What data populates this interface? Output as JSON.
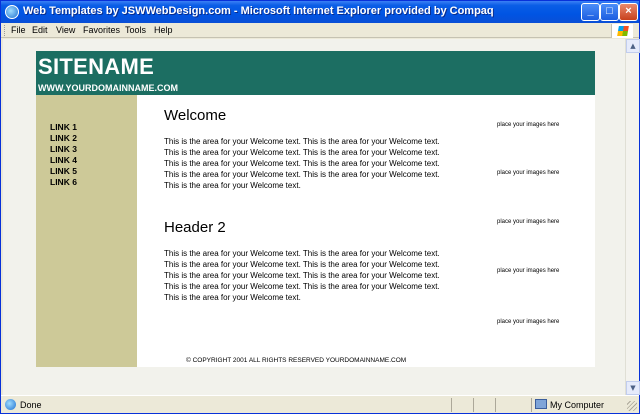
{
  "window": {
    "title": "Web Templates by JSWWebDesign.com - Microsoft Internet Explorer provided by Compaq",
    "buttons": {
      "minimize": "_",
      "maximize": "□",
      "close": "×"
    }
  },
  "menu": {
    "items": [
      "File",
      "Edit",
      "View",
      "Favorites",
      "Tools",
      "Help"
    ]
  },
  "page": {
    "site_name": "SITENAME",
    "domain": "WWW.YOURDOMAINNAME.COM",
    "nav_links": [
      "LINK 1",
      "LINK 2",
      "LINK 3",
      "LINK 4",
      "LINK 5",
      "LINK 6"
    ],
    "sections": [
      {
        "heading": "Welcome",
        "text": "This is the area for your Welcome text. This is the area for your Welcome text. This is the area for your Welcome text. This is the area for your Welcome text. This is the area for your Welcome text. This is the area for your Welcome text. This is the area for your Welcome text. This is the area for your Welcome text. This is the area for your Welcome text."
      },
      {
        "heading": "Header 2",
        "text": "This is the area for your Welcome text. This is the area for your Welcome text. This is the area for your Welcome text. This is the area for your Welcome text. This is the area for your Welcome text. This is the area for your Welcome text. This is the area for your Welcome text. This is the area for your Welcome text. This is the area for your Welcome text."
      }
    ],
    "image_placeholders": [
      "place your images here",
      "place your images here",
      "place your images here",
      "place your images here",
      "place your images here"
    ],
    "footer": "© COPYRIGHT 2001 ALL RIGHTS RESERVED YOURDOMAINNAME.COM"
  },
  "status": {
    "left": "Done",
    "zone": "My Computer"
  },
  "colors": {
    "header_band": "#1c6e62",
    "sidebar": "#cdc998",
    "titlebar": "#0054e3"
  },
  "icons": [
    "ie-icon",
    "windows-logo-icon",
    "done-icon",
    "my-computer-icon",
    "scroll-up-icon",
    "scroll-down-icon",
    "resize-grip-icon"
  ]
}
